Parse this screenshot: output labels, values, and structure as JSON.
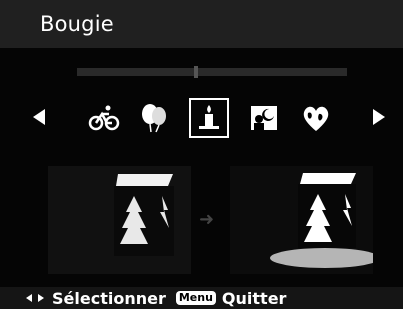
{
  "header": {
    "title": "Bougie"
  },
  "progress": {
    "fraction": 0.44
  },
  "scene_selector": {
    "icons": [
      "bicycle-icon",
      "balloons-icon",
      "candle-icon",
      "night-portrait-icon",
      "globe-heart-icon"
    ],
    "selected": "candle-icon"
  },
  "footer": {
    "select_label": "Sélectionner",
    "menu_key": "Menu",
    "quit_label": "Quitter"
  }
}
